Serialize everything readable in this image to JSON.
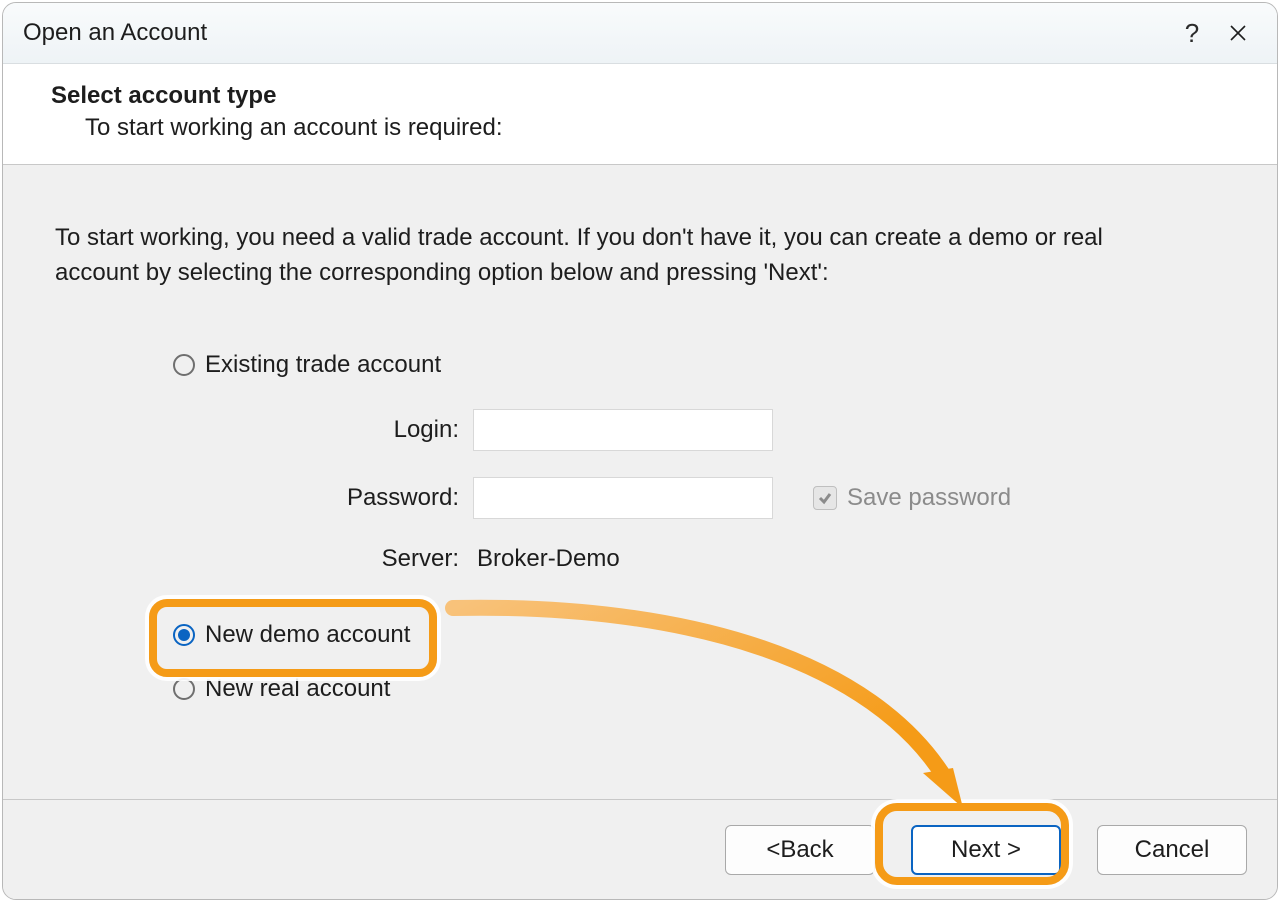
{
  "titlebar": {
    "title": "Open an Account",
    "help_tooltip": "?",
    "close_tooltip": "✕"
  },
  "header": {
    "title": "Select account type",
    "subtitle": "To start working an account is required:"
  },
  "body": {
    "intro": "To start working, you need a valid trade account. If you don't have it, you can create a demo or real account by selecting the corresponding option below and pressing 'Next':"
  },
  "options": {
    "existing": {
      "label": "Existing trade account",
      "login_label": "Login:",
      "login_value": "",
      "password_label": "Password:",
      "password_value": "",
      "save_password_label": "Save password",
      "server_label": "Server:",
      "server_value": "Broker-Demo"
    },
    "demo": {
      "label": "New demo account"
    },
    "real": {
      "label": "New real account"
    },
    "selected": "demo"
  },
  "footer": {
    "back": "<Back",
    "next": "Next >",
    "cancel": "Cancel"
  },
  "annotations": {
    "highlight_demo": true,
    "highlight_next": true,
    "arrow_color": "#f59b17"
  }
}
